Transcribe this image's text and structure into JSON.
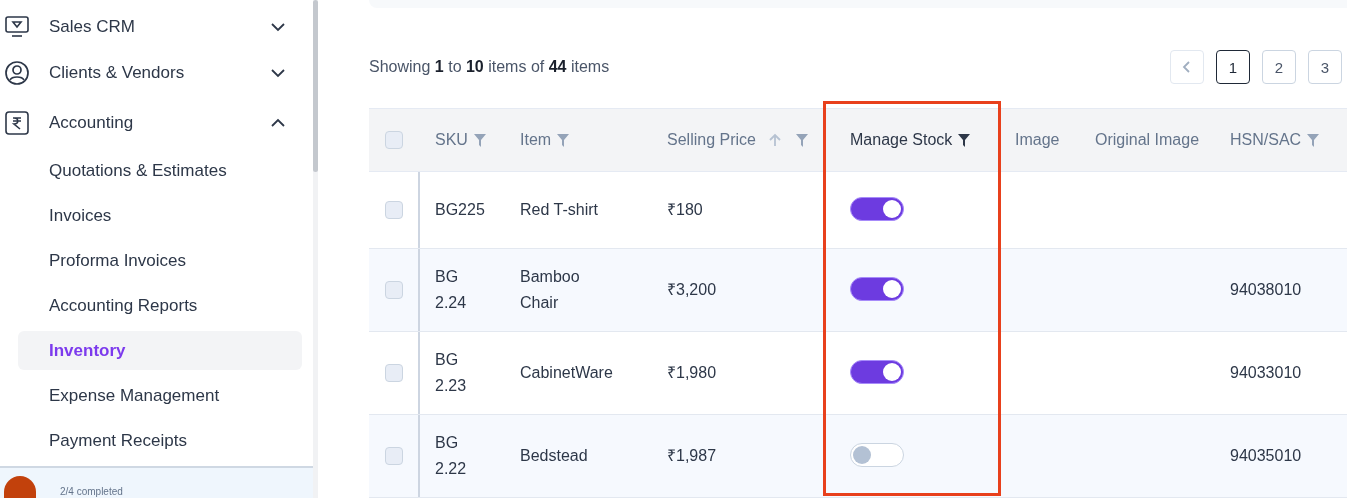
{
  "sidebar": {
    "items": [
      {
        "label": "Sales CRM",
        "expanded": false
      },
      {
        "label": "Clients & Vendors",
        "expanded": false
      },
      {
        "label": "Accounting",
        "expanded": true,
        "children": [
          {
            "label": "Quotations & Estimates",
            "selected": false
          },
          {
            "label": "Invoices",
            "selected": false
          },
          {
            "label": "Proforma Invoices",
            "selected": false
          },
          {
            "label": "Accounting Reports",
            "selected": false
          },
          {
            "label": "Inventory",
            "selected": true
          },
          {
            "label": "Expense Management",
            "selected": false
          },
          {
            "label": "Payment Receipts",
            "selected": false
          }
        ]
      }
    ],
    "progress": "2/4 completed"
  },
  "summary": "Showing **1** to **10** items of **44** items",
  "pagination": [
    {
      "label": "1",
      "selected": true
    },
    {
      "label": "2",
      "selected": false
    },
    {
      "label": "3",
      "selected": false
    }
  ],
  "table": {
    "select_all": false,
    "columns": [
      {
        "label": "SKU",
        "filter": true,
        "filter_active": false,
        "sort": false
      },
      {
        "label": "Item",
        "filter": true,
        "filter_active": false,
        "sort": false
      },
      {
        "label": "Selling Price",
        "filter": true,
        "filter_active": false,
        "sort": true
      },
      {
        "label": "Manage Stock",
        "filter": true,
        "filter_active": true,
        "sort": false
      },
      {
        "label": "Image"
      },
      {
        "label": "Original Image"
      },
      {
        "label": "HSN/SAC",
        "filter": true,
        "filter_active": false,
        "sort": false
      }
    ],
    "rows": [
      {
        "checked": false,
        "sku": "BG225",
        "item": "Red T-shirt",
        "price": "₹180",
        "manage_stock": true
      },
      {
        "checked": false,
        "sku": "BG 2.24",
        "item": "Bamboo Chair",
        "price": "₹3,200",
        "manage_stock": true,
        "hsn": "94038010"
      },
      {
        "checked": false,
        "sku": "BG 2.23",
        "item": "CabinetWare",
        "price": "₹1,980",
        "manage_stock": true,
        "hsn": "94033010"
      },
      {
        "checked": false,
        "sku": "BG 2.22",
        "item": "Bedstead",
        "price": "₹1,987",
        "manage_stock": false,
        "hsn": "94035010"
      }
    ]
  }
}
